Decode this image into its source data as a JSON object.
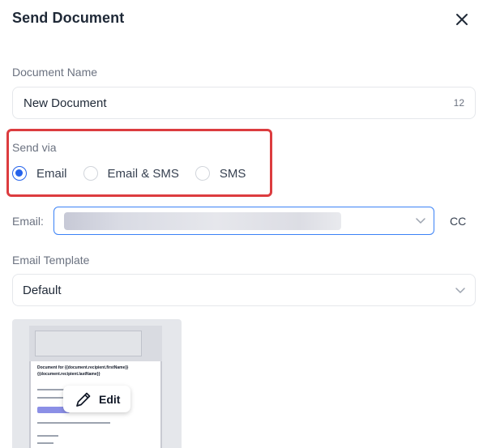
{
  "header": {
    "title": "Send Document"
  },
  "document_name": {
    "label": "Document Name",
    "value": "New Document",
    "char_count": "12"
  },
  "send_via": {
    "label": "Send via",
    "options": [
      {
        "label": "Email",
        "selected": true
      },
      {
        "label": "Email & SMS",
        "selected": false
      },
      {
        "label": "SMS",
        "selected": false
      }
    ]
  },
  "email": {
    "label": "Email:",
    "cc_label": "CC"
  },
  "template": {
    "label": "Email Template",
    "value": "Default"
  },
  "preview": {
    "doc_title": "Document for {{document.recipient.firstName}} {{document.recipient.lastName}}",
    "edit_label": "Edit"
  },
  "colors": {
    "accent": "#2563eb",
    "highlight_border": "#dc3c3f",
    "input_focus": "#3b82f6"
  }
}
